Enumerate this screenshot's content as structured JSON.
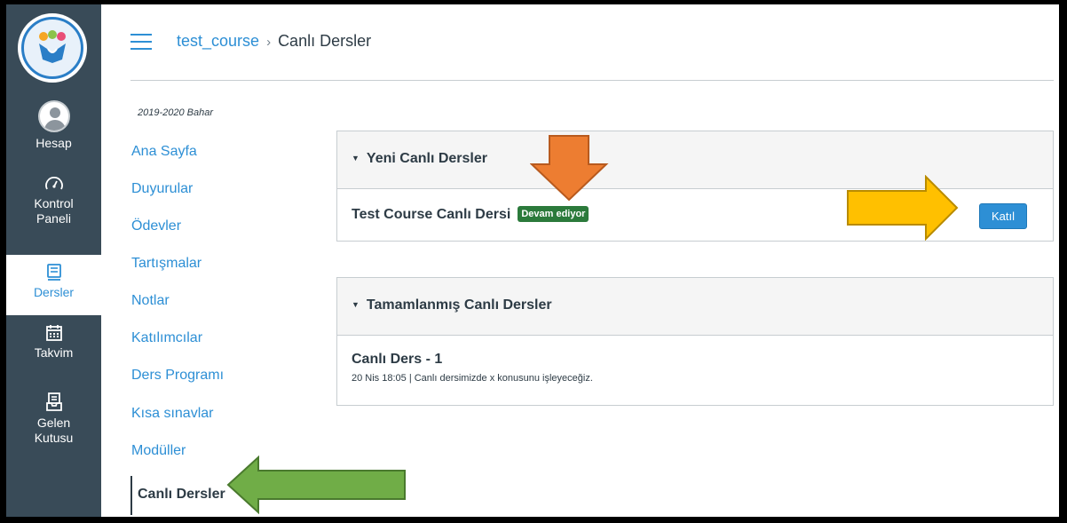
{
  "global_nav": {
    "account": "Hesap",
    "dashboard_line1": "Kontrol",
    "dashboard_line2": "Paneli",
    "courses": "Dersler",
    "calendar": "Takvim",
    "inbox_line1": "Gelen",
    "inbox_line2": "Kutusu"
  },
  "breadcrumb": {
    "course": "test_course",
    "separator": "›",
    "current": "Canlı Dersler"
  },
  "term": "2019-2020 Bahar",
  "course_nav": [
    "Ana Sayfa",
    "Duyurular",
    "Ödevler",
    "Tartışmalar",
    "Notlar",
    "Katılımcılar",
    "Ders Programı",
    "Kısa sınavlar",
    "Modüller",
    "Canlı Dersler"
  ],
  "new_panel": {
    "title": "Yeni Canlı Dersler",
    "lesson_name": "Test Course Canlı Dersi",
    "status": "Devam ediyor",
    "join_label": "Katıl"
  },
  "completed_panel": {
    "title": "Tamamlanmış Canlı Dersler",
    "lesson_name": "Canlı Ders - 1",
    "lesson_desc": "20 Nis 18:05  |  Canlı dersimizde x konusunu işleyeceğiz."
  },
  "colors": {
    "nav_bg": "#394b58",
    "link": "#2d8fd5",
    "badge": "#2b7a3b",
    "arrow_orange": "#ed7d31",
    "arrow_yellow": "#ffc000",
    "arrow_green": "#70ad47"
  }
}
